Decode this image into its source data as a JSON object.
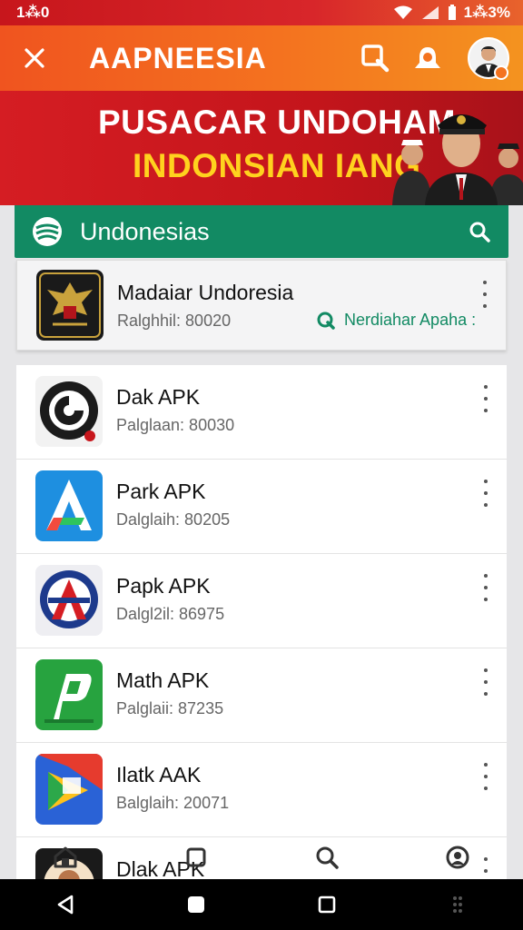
{
  "status_bar": {
    "time": "1⁂0",
    "battery": "1⁂3%"
  },
  "app_bar": {
    "title": "AAPNEESIA"
  },
  "banner": {
    "line1": "PUSACAR UNDOHAM",
    "line2": "INDONSIAN IANG"
  },
  "section": {
    "title": "Undonesias"
  },
  "featured": {
    "name": "Madaiar Undoresia",
    "meta": "Ralghhil: 80020",
    "action_label": "Nerdiahar Apaha :"
  },
  "apps": [
    {
      "name": "Dak  APK",
      "meta": "Palglaan: 80030",
      "icon": "swirl-badge-icon"
    },
    {
      "name": "Park APK",
      "meta": "Dalglaih: 80205",
      "icon": "blue-a-icon"
    },
    {
      "name": "Papk APK",
      "meta": "Dalgl2il: 86975",
      "icon": "red-a-badge-icon"
    },
    {
      "name": "Math APK",
      "meta": "Palglaii: 87235",
      "icon": "green-p-icon"
    },
    {
      "name": "Ilatk AAK",
      "meta": "Balglaih: 20071",
      "icon": "play-wedge-icon"
    },
    {
      "name": "Dlak APK",
      "meta": "",
      "icon": "portrait-badge-icon"
    }
  ],
  "colors": {
    "status_bar": "#c7161c",
    "app_bar": "#f4731f",
    "banner": "#d51d23",
    "banner_accent": "#ffd21e",
    "section_header": "#128a63"
  },
  "app_nav_icons": [
    "home-icon",
    "square-icon",
    "search-icon",
    "profile-icon"
  ],
  "system_nav_icons": [
    "back-icon",
    "home-circle-icon",
    "recents-icon"
  ]
}
